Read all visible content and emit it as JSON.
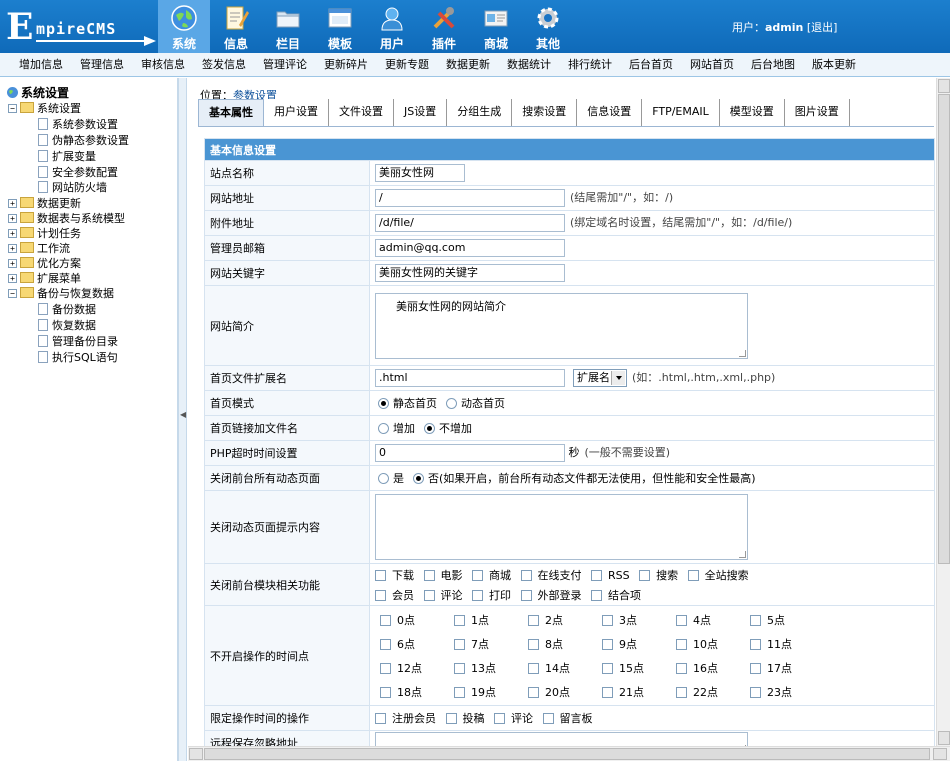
{
  "logo": {
    "initial": "E",
    "rest": "mpireCMS"
  },
  "nav": [
    {
      "label": "系统",
      "icon": "globe-icon",
      "active": true
    },
    {
      "label": "信息",
      "icon": "document-icon"
    },
    {
      "label": "栏目",
      "icon": "folder-icon"
    },
    {
      "label": "模板",
      "icon": "template-icon"
    },
    {
      "label": "用户",
      "icon": "user-icon"
    },
    {
      "label": "插件",
      "icon": "tools-icon"
    },
    {
      "label": "商城",
      "icon": "shop-icon"
    },
    {
      "label": "其他",
      "icon": "gear-icon"
    }
  ],
  "user": {
    "prefix": "用户：",
    "name": "admin",
    "logout": "[退出]"
  },
  "subnav": [
    "增加信息",
    "管理信息",
    "审核信息",
    "签发信息",
    "管理评论",
    "更新碎片",
    "更新专题",
    "数据更新",
    "数据统计",
    "排行统计",
    "后台首页",
    "网站首页",
    "后台地图",
    "版本更新"
  ],
  "tree": {
    "root": "系统设置",
    "system": "系统设置",
    "system_children": [
      "系统参数设置",
      "伪静态参数设置",
      "扩展变量",
      "安全参数配置",
      "网站防火墙"
    ],
    "groups": [
      "数据更新",
      "数据表与系统模型",
      "计划任务",
      "工作流",
      "优化方案",
      "扩展菜单"
    ],
    "backup": "备份与恢复数据",
    "backup_children": [
      "备份数据",
      "恢复数据",
      "管理备份目录",
      "执行SQL语句"
    ]
  },
  "breadcrumb": {
    "prefix": "位置：",
    "link": "参数设置"
  },
  "tabs": [
    "基本属性",
    "用户设置",
    "文件设置",
    "JS设置",
    "分组生成",
    "搜索设置",
    "信息设置",
    "FTP/EMAIL",
    "模型设置",
    "图片设置"
  ],
  "form": {
    "section_title": "基本信息设置",
    "site_name": {
      "label": "站点名称",
      "value": "美丽女性网"
    },
    "site_url": {
      "label": "网站地址",
      "value": "/",
      "hint": "(结尾需加\"/\"，如：/)"
    },
    "attach_url": {
      "label": "附件地址",
      "value": "/d/file/",
      "hint": "(绑定域名时设置，结尾需加\"/\"，如：/d/file/)"
    },
    "admin_email": {
      "label": "管理员邮箱",
      "value": "admin@qq.com"
    },
    "keywords": {
      "label": "网站关键字",
      "value": "美丽女性网的关键字"
    },
    "intro": {
      "label": "网站简介",
      "value": "美丽女性网的网站简介"
    },
    "index_ext": {
      "label": "首页文件扩展名",
      "value": ".html",
      "select": "扩展名",
      "hint": "(如：.html,.htm,.xml,.php)"
    },
    "index_mode": {
      "label": "首页模式",
      "opt1": "静态首页",
      "opt2": "动态首页"
    },
    "index_link": {
      "label": "首页链接加文件名",
      "opt1": "增加",
      "opt2": "不增加"
    },
    "php_timeout": {
      "label": "PHP超时时间设置",
      "value": "0",
      "unit": "秒",
      "hint": "(一般不需要设置)"
    },
    "close_dynamic": {
      "label": "关闭前台所有动态页面",
      "opt1": "是",
      "opt2": "否",
      "hint": "(如果开启，前台所有动态文件都无法使用，但性能和安全性最高)"
    },
    "close_msg": {
      "label": "关闭动态页面提示内容"
    },
    "close_modules": {
      "label": "关闭前台模块相关功能",
      "row1": [
        "下载",
        "电影",
        "商城",
        "在线支付",
        "RSS",
        "搜索",
        "全站搜索"
      ],
      "row2": [
        "会员",
        "评论",
        "打印",
        "外部登录",
        "结合项"
      ]
    },
    "closed_hours": {
      "label": "不开启操作的时间点",
      "hours": [
        "0点",
        "1点",
        "2点",
        "3点",
        "4点",
        "5点",
        "6点",
        "7点",
        "8点",
        "9点",
        "10点",
        "11点",
        "12点",
        "13点",
        "14点",
        "15点",
        "16点",
        "17点",
        "18点",
        "19点",
        "20点",
        "21点",
        "22点",
        "23点"
      ]
    },
    "limit_ops": {
      "label": "限定操作时间的操作",
      "items": [
        "注册会员",
        "投稿",
        "评论",
        "留言板"
      ]
    },
    "remote_ignore": {
      "label": "远程保存忽略地址"
    }
  }
}
